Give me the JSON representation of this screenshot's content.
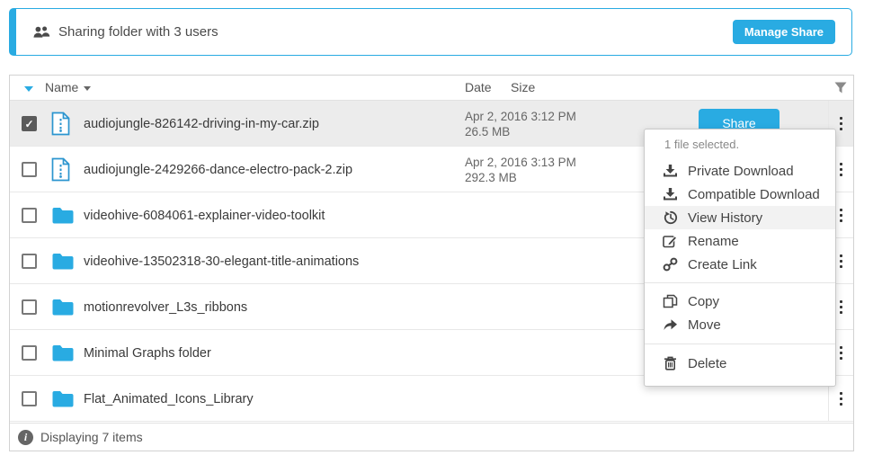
{
  "colors": {
    "accent": "#29abe2",
    "selected_row_bg": "#ececec"
  },
  "banner": {
    "message": "Sharing folder with 3 users",
    "manage_label": "Manage Share"
  },
  "table": {
    "headers": {
      "name": "Name",
      "date": "Date",
      "size": "Size"
    },
    "rows": [
      {
        "type": "file",
        "name": "audiojungle-826142-driving-in-my-car.zip",
        "date": "Apr 2, 2016 3:12 PM",
        "size": "26.5 MB",
        "checked": true,
        "share_label": "Share"
      },
      {
        "type": "file",
        "name": "audiojungle-2429266-dance-electro-pack-2.zip",
        "date": "Apr 2, 2016 3:13 PM",
        "size": "292.3 MB"
      },
      {
        "type": "folder",
        "name": "videohive-6084061-explainer-video-toolkit"
      },
      {
        "type": "folder",
        "name": "videohive-13502318-30-elegant-title-animations"
      },
      {
        "type": "folder",
        "name": "motionrevolver_L3s_ribbons"
      },
      {
        "type": "folder",
        "name": "Minimal Graphs folder"
      },
      {
        "type": "folder",
        "name": "Flat_Animated_Icons_Library"
      }
    ]
  },
  "context_menu": {
    "status": "1 file selected.",
    "items": [
      {
        "label": "Private Download"
      },
      {
        "label": "Compatible Download"
      },
      {
        "label": "View History",
        "highlighted": true
      },
      {
        "label": "Rename"
      },
      {
        "label": "Create Link"
      },
      {
        "label": "Copy"
      },
      {
        "label": "Move"
      },
      {
        "label": "Delete"
      }
    ]
  },
  "footer": {
    "status": "Displaying 7 items"
  }
}
